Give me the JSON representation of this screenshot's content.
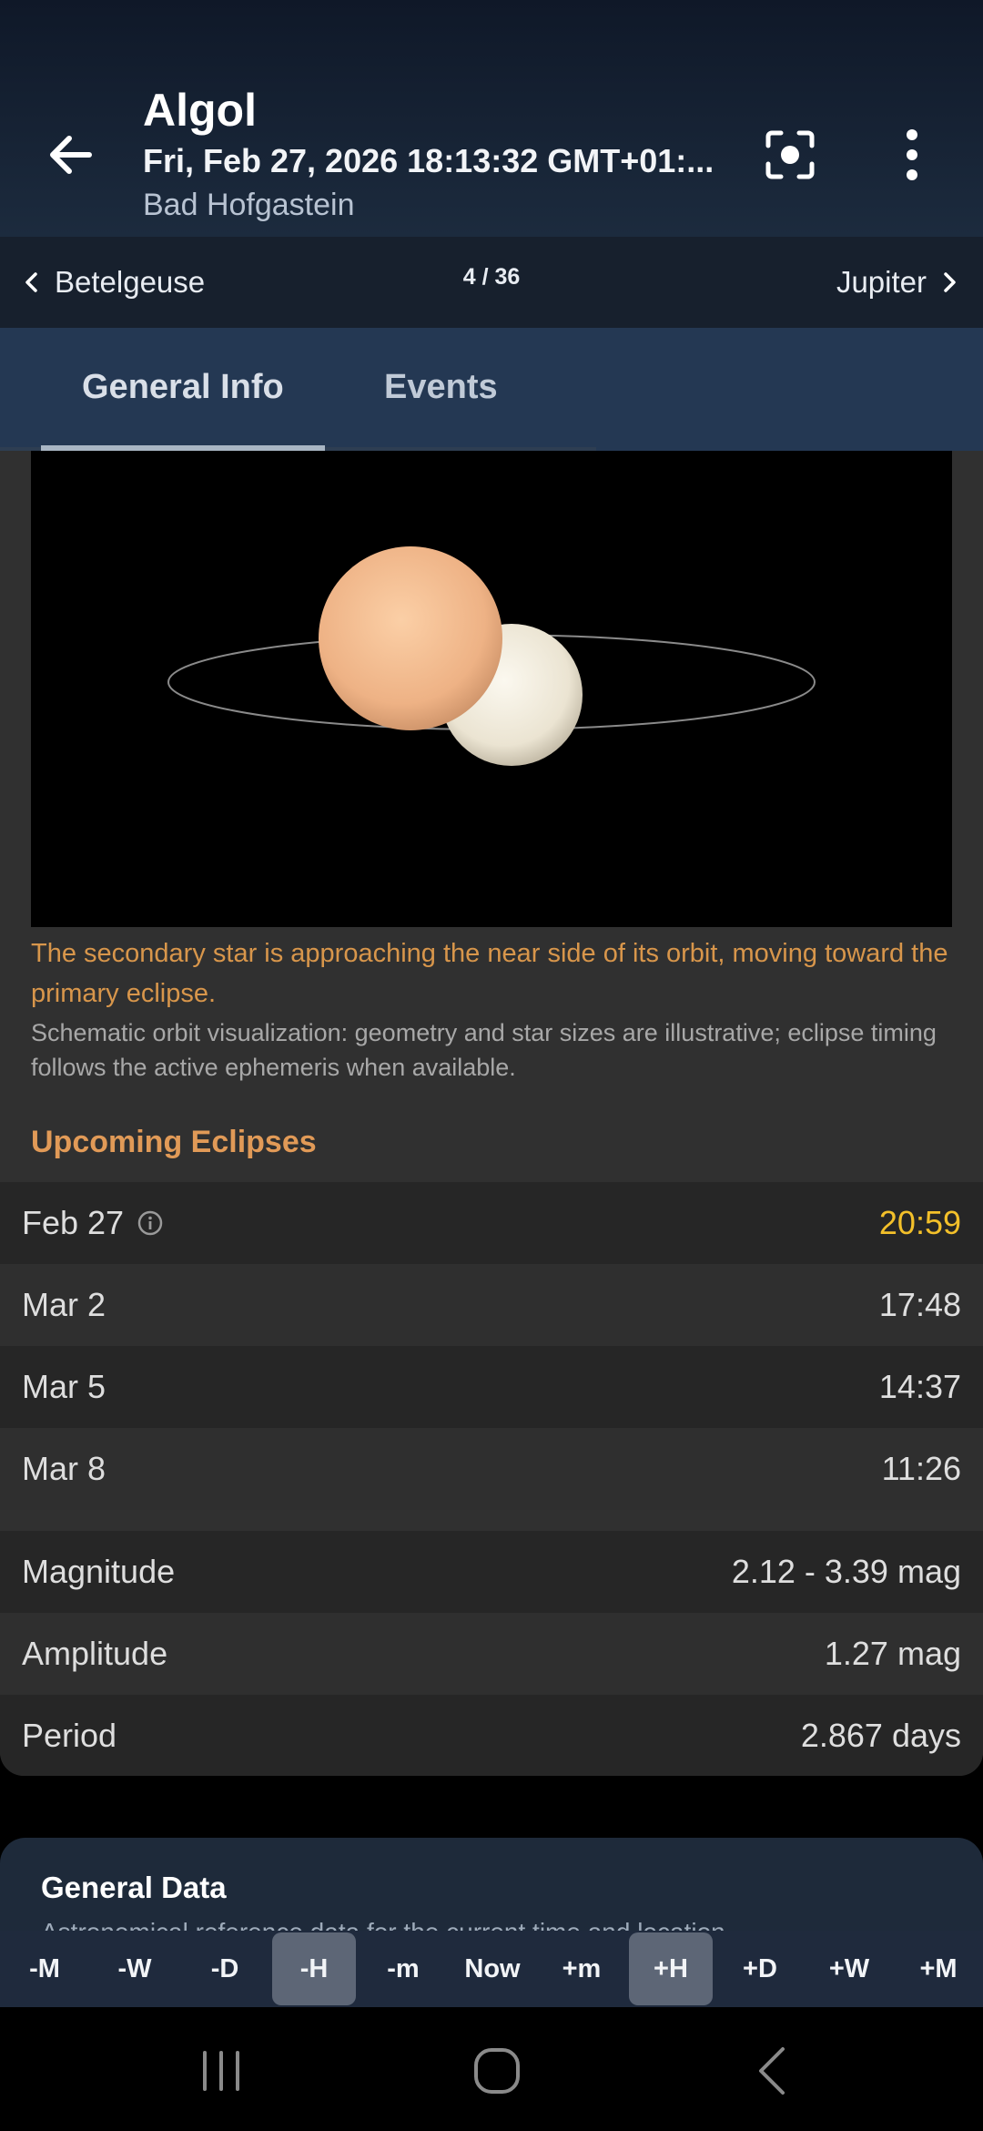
{
  "header": {
    "title": "Algol",
    "datetime": "Fri, Feb 27, 2026 18:13:32 GMT+01:...",
    "location": "Bad Hofgastein"
  },
  "nav": {
    "prev_label": "Betelgeuse",
    "counter": "4 / 36",
    "next_label": "Jupiter"
  },
  "tabs": [
    {
      "label": "General Info",
      "active": true
    },
    {
      "label": "Events",
      "active": false
    }
  ],
  "visualization": {
    "caption": "The secondary star is approaching the near side of its orbit, moving toward the primary eclipse.",
    "note": "Schematic orbit visualization: geometry and star sizes are illustrative; eclipse timing follows the active ephemeris when available.",
    "colors": {
      "primary_star": "#f2b98c",
      "secondary_star": "#f3eee0",
      "orbit": "#8a8a8a"
    }
  },
  "eclipses": {
    "title": "Upcoming Eclipses",
    "rows": [
      {
        "date": "Feb 27",
        "time": "20:59",
        "highlight": true,
        "icon": "info-icon"
      },
      {
        "date": "Mar 2",
        "time": "17:48"
      },
      {
        "date": "Mar 5",
        "time": "14:37"
      },
      {
        "date": "Mar 8",
        "time": "11:26"
      }
    ]
  },
  "properties": [
    {
      "label": "Magnitude",
      "value": "2.12 - 3.39 mag"
    },
    {
      "label": "Amplitude",
      "value": "1.27 mag"
    },
    {
      "label": "Period",
      "value": "2.867 days"
    }
  ],
  "general_data": {
    "title": "General Data",
    "subtitle": "Astronomical reference data for the current time and location"
  },
  "timebar": {
    "buttons": [
      "-M",
      "-W",
      "-D",
      "-H",
      "-m",
      "Now",
      "+m",
      "+H",
      "+D",
      "+W",
      "+M"
    ],
    "active": [
      "-H",
      "+H"
    ]
  },
  "colors": {
    "accent_orange": "#e19a57",
    "highlight_yellow": "#f3c02a",
    "header_bg": "#1c2b3e",
    "tab_bg": "#243853"
  }
}
